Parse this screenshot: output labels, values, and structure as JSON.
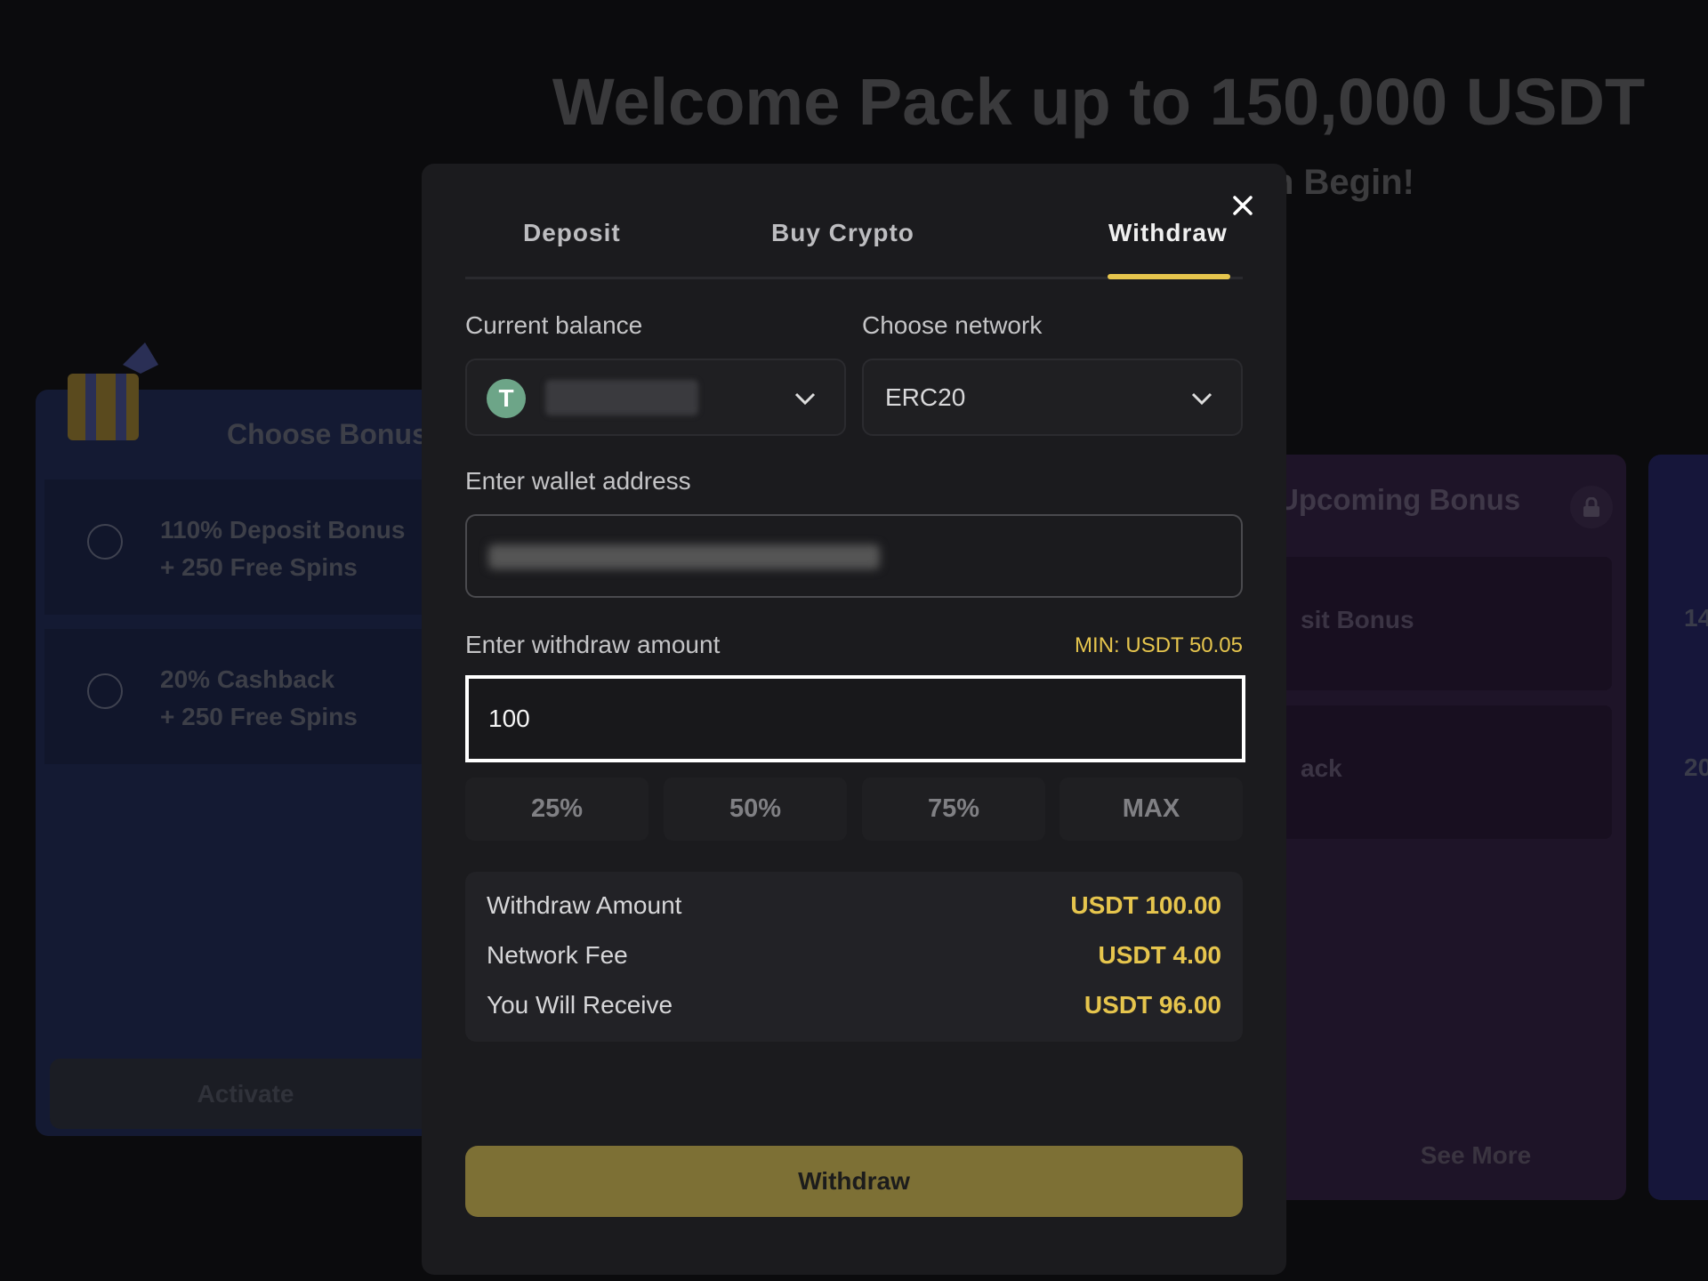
{
  "background": {
    "hero_title": "Welcome Pack up to 150,000 USDT",
    "hero_subtitle": "n Begin!",
    "choose_bonus": {
      "title": "Choose Bonus",
      "options": [
        {
          "line1": "110% Deposit Bonus",
          "line2": "+ 250 Free Spins"
        },
        {
          "line1": "20% Cashback",
          "line2": "+ 250 Free Spins"
        }
      ],
      "activate_label": "Activate"
    },
    "upcoming_bonus": {
      "title": "Upcoming Bonus",
      "rows": [
        "sit Bonus",
        "ack"
      ],
      "see_more": "See More"
    },
    "third_card": {
      "rows": [
        "14",
        "20"
      ]
    }
  },
  "modal": {
    "tabs": [
      {
        "label": "Deposit"
      },
      {
        "label": "Buy Crypto"
      },
      {
        "label": "Withdraw",
        "active": true
      }
    ],
    "current_balance_label": "Current balance",
    "currency_icon": "tether-usdt-icon",
    "choose_network_label": "Choose network",
    "network_value": "ERC20",
    "wallet_label": "Enter wallet address",
    "amount_label": "Enter withdraw amount",
    "min_text": "MIN: USDT 50.05",
    "amount_value": "100",
    "percent_buttons": [
      "25%",
      "50%",
      "75%",
      "MAX"
    ],
    "summary": [
      {
        "label": "Withdraw Amount",
        "value": "USDT 100.00"
      },
      {
        "label": "Network Fee",
        "value": "USDT 4.00"
      },
      {
        "label": "You Will Receive",
        "value": "USDT 96.00"
      }
    ],
    "submit_label": "Withdraw"
  },
  "colors": {
    "accent": "#e6c54d",
    "button": "#7d7035",
    "modal_bg": "#1b1b1e"
  }
}
